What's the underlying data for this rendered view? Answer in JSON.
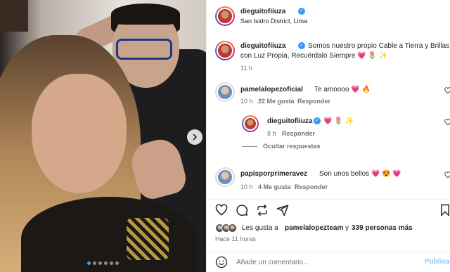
{
  "post": {
    "username": "dieguitofiiuza",
    "location": "San Isidro District, Lima",
    "caption": "Somos nuestro propio Cable a Tierra y Brillas",
    "caption_line2": "con Luz Propia, Recuérdalo Siempre 💗 🌷 ✨",
    "caption_time": "11 h",
    "carousel_dots": 6,
    "carousel_active": 0
  },
  "comments": [
    {
      "username": "pamelalopezoficial",
      "text": "Te amoooo 💗 🔥",
      "time": "10 h",
      "likes": "22 Me gusta",
      "reply": "Responder",
      "replies": [
        {
          "username": "dieguitofiiuza",
          "text": "💗 🌷 ✨",
          "time": "8 h",
          "reply": "Responder"
        }
      ],
      "hide_replies": "Ocultar respuestas"
    },
    {
      "username": "papisporprimeravez",
      "text": "Son unos bellos 💗 😍 💗",
      "time": "10 h",
      "likes": "4 Me gusta",
      "reply": "Responder"
    }
  ],
  "likes_summary": {
    "prefix": "Les gusta a",
    "user": "pamelalopezteam",
    "middle": "y",
    "count": "339 personas más"
  },
  "posted_ago": "Hace 11 horas",
  "comment_box": {
    "placeholder": "Añade un comentario...",
    "publish_label": "Publicar"
  },
  "icons": {
    "verified": "verified-badge-icon",
    "next": "chevron-right-icon",
    "like": "heart-icon",
    "comment": "comment-bubble-icon",
    "share": "send-icon",
    "save": "bookmark-icon",
    "emoji": "emoji-smiley-icon"
  },
  "colors": {
    "verified": "#3897f0",
    "publish": "#8ec5f7",
    "muted_text": "#737373"
  }
}
